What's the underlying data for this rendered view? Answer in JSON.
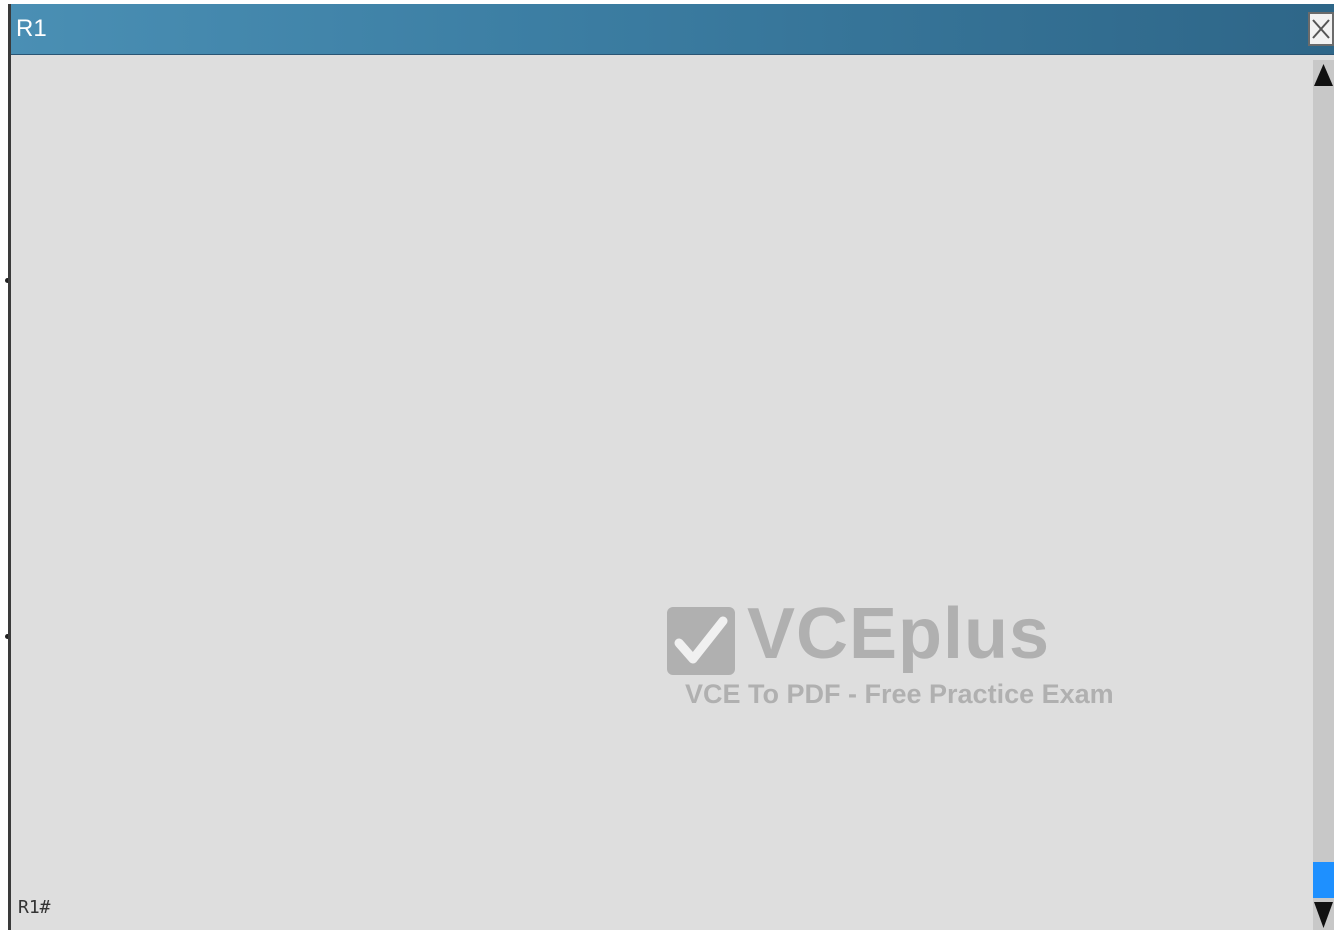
{
  "window": {
    "title": "R1",
    "close_icon": "close-x-icon"
  },
  "terminal": {
    "prompt": "R1#"
  },
  "scrollbar": {
    "up_icon": "scroll-up-arrow-icon",
    "down_icon": "scroll-down-arrow-icon",
    "thumb_color": "#1e90ff",
    "position": 0.97
  },
  "watermark": {
    "logo": "VCEplus",
    "tagline": "VCE To PDF - Free Practice Exam",
    "icon": "checkmark-icon"
  },
  "colors": {
    "titlebar": "#3c7ea3",
    "terminal_bg": "#dedede"
  }
}
